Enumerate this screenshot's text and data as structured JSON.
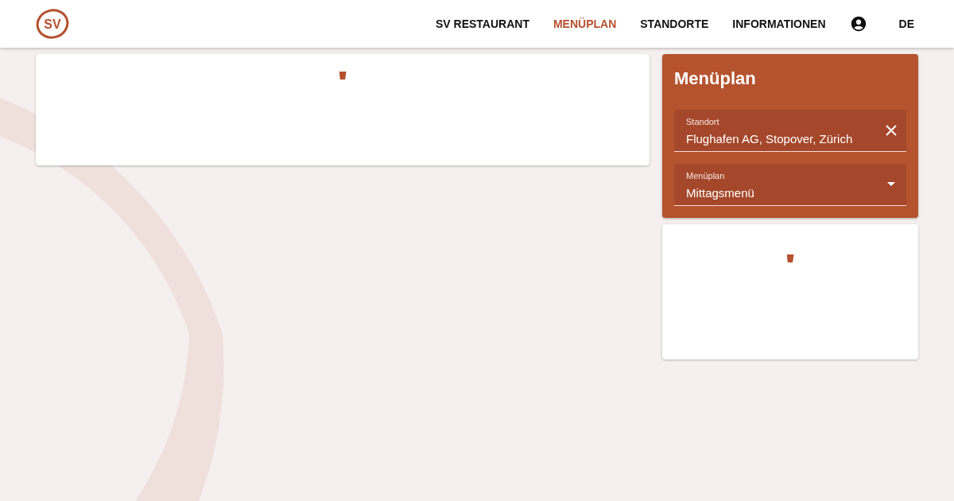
{
  "logo": {
    "text": "SV"
  },
  "nav": [
    {
      "label": "SV RESTAURANT",
      "selected": false
    },
    {
      "label": "MENÜPLAN",
      "selected": true
    },
    {
      "label": "STANDORTE",
      "selected": false
    },
    {
      "label": "INFORMATIONEN",
      "selected": false
    }
  ],
  "language": "DE",
  "filter_panel": {
    "title": "Menüplan",
    "fields": [
      {
        "kind": "clearable",
        "label": "Standort",
        "value": "Flughafen AG, Stopover, Zürich"
      },
      {
        "kind": "select",
        "label": "Menüplan",
        "value": "Mittagsmenü"
      }
    ]
  }
}
